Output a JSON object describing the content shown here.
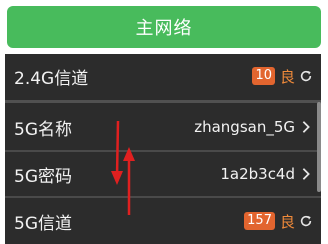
{
  "header": {
    "title": "主网络"
  },
  "rows": [
    {
      "label": "2.4G信道",
      "badge": "10",
      "quality": "良",
      "action_icon": "refresh-icon"
    },
    {
      "label": "5G名称",
      "value": "zhangsan_5G",
      "action_icon": "chevron-right-icon"
    },
    {
      "label": "5G密码",
      "value": "1a2b3c4d",
      "action_icon": "chevron-right-icon"
    },
    {
      "label": "5G信道",
      "badge": "157",
      "quality": "良",
      "action_icon": "refresh-icon"
    }
  ],
  "colors": {
    "header_green": "#48bb5c",
    "panel_bg": "#2c2c2c",
    "badge_orange": "#e2652f",
    "quality_orange": "#f08a3a",
    "annotation_red": "#e02020"
  }
}
